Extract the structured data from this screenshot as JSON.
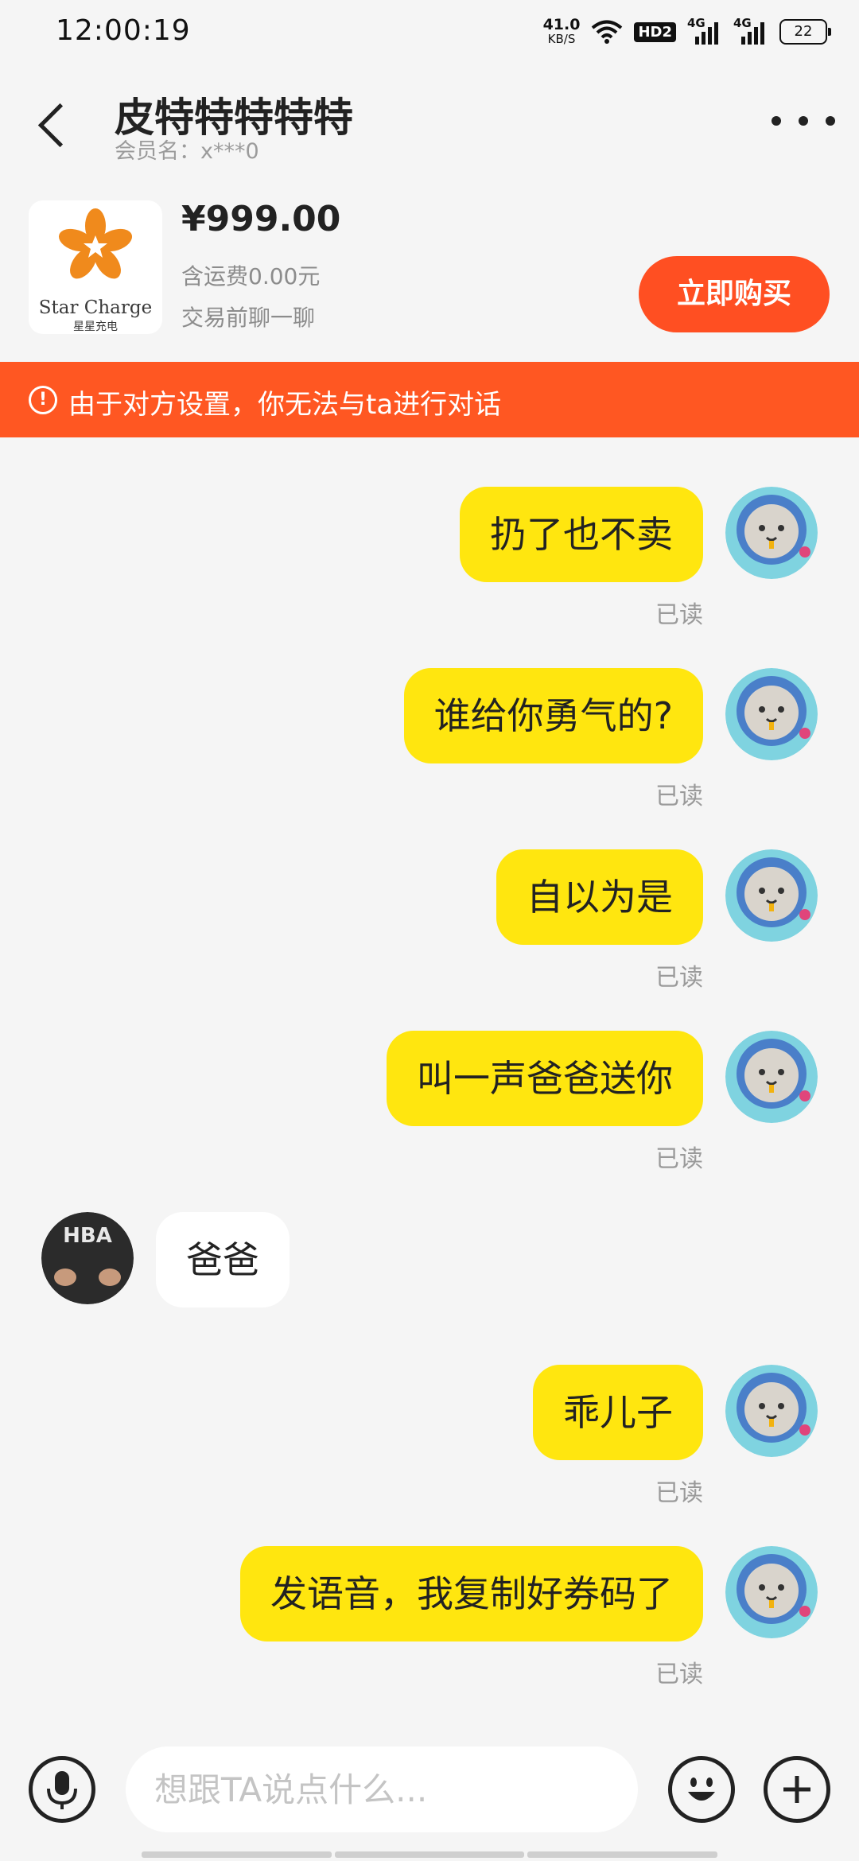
{
  "status_bar": {
    "time": "12:00:19",
    "speed_value": "41.0",
    "speed_unit": "KB/S",
    "hd_label": "HD2",
    "network_1": "4G",
    "network_2": "4G",
    "battery": "22"
  },
  "header": {
    "title": "皮特特特特特",
    "member_label": "会员名：x***0"
  },
  "product": {
    "brand": "Star Charge",
    "brand_cn": "星星充电",
    "price": "¥999.00",
    "shipping": "含运费0.00元",
    "chat_hint": "交易前聊一聊",
    "buy_label": "立即购买"
  },
  "banner": {
    "icon": "!",
    "text": "由于对方设置，你无法与ta进行对话"
  },
  "messages": [
    {
      "side": "mine",
      "text": "扔了也不卖",
      "status": "已读"
    },
    {
      "side": "mine",
      "text": "谁给你勇气的?",
      "status": "已读"
    },
    {
      "side": "mine",
      "text": "自以为是",
      "status": "已读"
    },
    {
      "side": "mine",
      "text": "叫一声爸爸送你",
      "status": "已读"
    },
    {
      "side": "theirs",
      "text": "爸爸",
      "avatar_text": "HBA"
    },
    {
      "side": "mine",
      "text": "乖儿子",
      "status": "已读"
    },
    {
      "side": "mine",
      "text": "发语音，我复制好券码了",
      "status": "已读"
    }
  ],
  "input_bar": {
    "placeholder": "想跟TA说点什么..."
  },
  "colors": {
    "accent_orange": "#ff5722",
    "buy_button": "#ff4f22",
    "my_bubble": "#ffe60f",
    "background": "#f5f5f5"
  },
  "icons": [
    "back-arrow-icon",
    "more-icon",
    "alert-icon",
    "mic-icon",
    "emoji-icon",
    "plus-icon",
    "wifi-icon",
    "signal-icon",
    "battery-icon"
  ]
}
